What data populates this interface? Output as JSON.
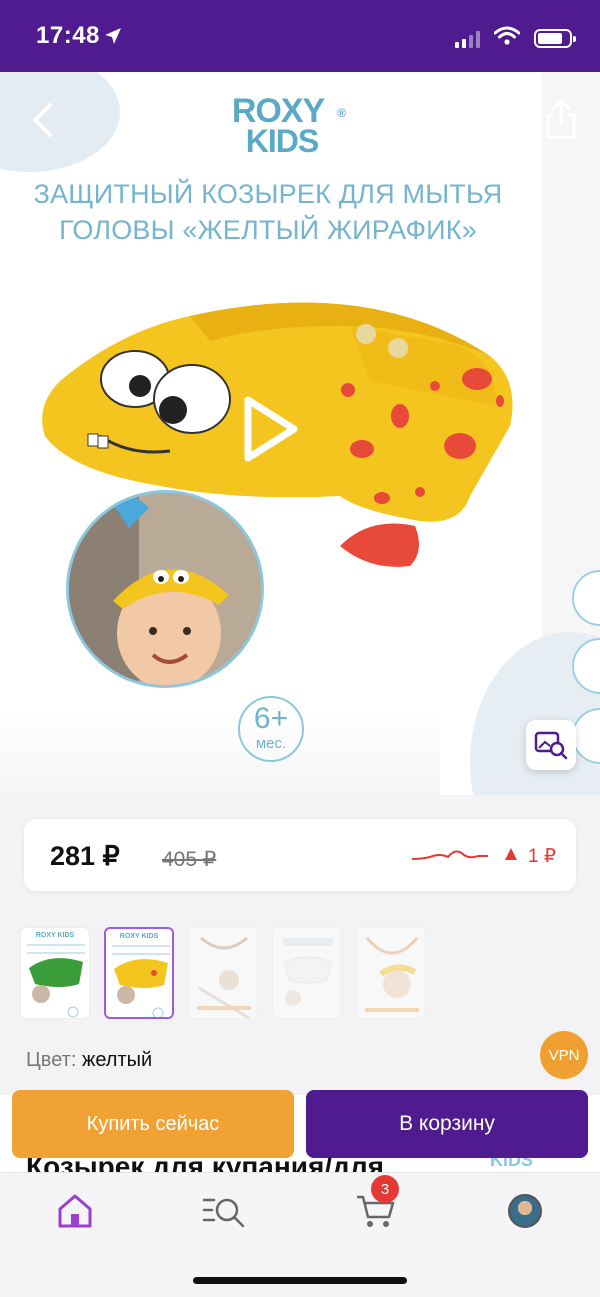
{
  "status_bar": {
    "time": "17:48"
  },
  "hero": {
    "brand_line1": "ROXY",
    "brand_line2": "KIDS",
    "brand_reg": "®",
    "title": "ЗАЩИТНЫЙ КОЗЫРЕК ДЛЯ МЫТЬЯ ГОЛОВЫ «ЖЕЛТЫЙ ЖИРАФИК»",
    "age_number": "6+",
    "age_unit": "мес."
  },
  "price": {
    "current": "281 ₽",
    "old": "405 ₽",
    "delta": "1 ₽"
  },
  "thumbnails": [
    {
      "label": "ROXY KIDS",
      "variant": "green"
    },
    {
      "label": "ROXY KIDS",
      "variant": "yellow",
      "selected": true
    },
    {
      "label": "",
      "variant": "faded"
    },
    {
      "label": "",
      "variant": "faded"
    },
    {
      "label": "",
      "variant": "faded"
    }
  ],
  "color": {
    "label": "Цвет:",
    "value": "желтый"
  },
  "vpn": "VPN",
  "actions": {
    "buy_now": "Купить сейчас",
    "to_cart": "В корзину"
  },
  "peek": {
    "title": "Козырек для купания/для",
    "logo": "KIDS"
  },
  "tabbar": {
    "cart_count": "3"
  },
  "colors": {
    "brand_purple": "#4f1b8e",
    "accent_orange": "#f0a234",
    "price_red": "#e53935"
  }
}
